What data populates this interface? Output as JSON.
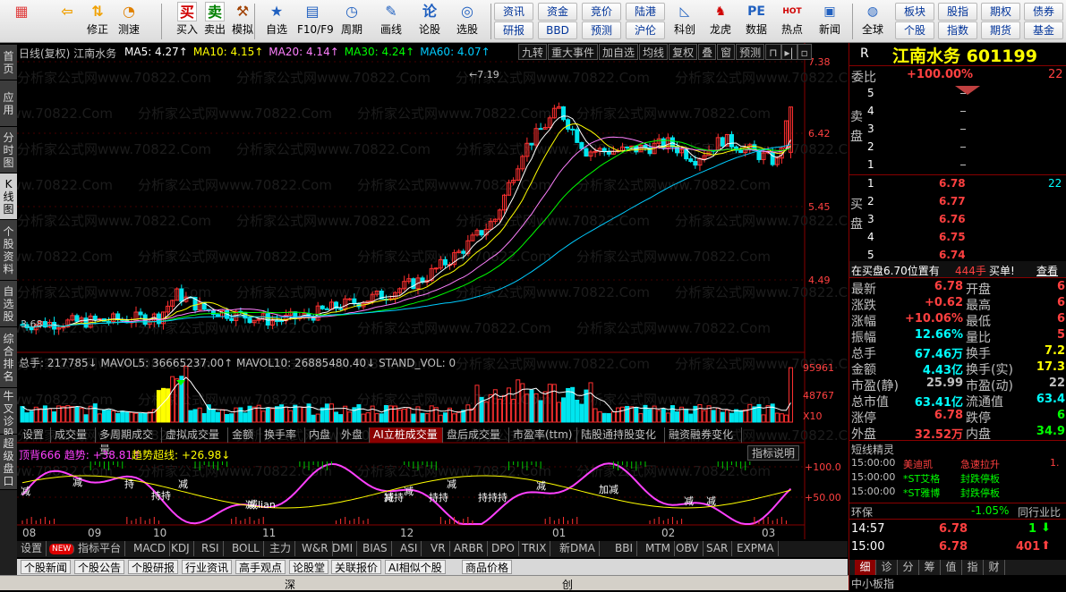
{
  "toolbar": {
    "big": [
      {
        "label": "",
        "icon": "windows-grid-icon"
      },
      {
        "label": "",
        "icon": "back-arrow-icon"
      },
      {
        "label": "修正",
        "icon": "up-down-arrows-icon"
      },
      {
        "label": "测速",
        "icon": "speed-gauge-icon"
      },
      {
        "label": "买入",
        "icon": "buy-icon",
        "glyph": "买"
      },
      {
        "label": "卖出",
        "icon": "sell-icon",
        "glyph": "卖"
      },
      {
        "label": "模拟",
        "icon": "hammer-icon"
      },
      {
        "label": "自选",
        "icon": "star-icon"
      },
      {
        "label": "F10/F9",
        "icon": "f10-icon"
      },
      {
        "label": "周期",
        "icon": "clock-icon"
      },
      {
        "label": "画线",
        "icon": "pencil-icon"
      },
      {
        "label": "论股",
        "icon": "talk-icon",
        "glyph": "论"
      },
      {
        "label": "选股",
        "icon": "select-stock-icon"
      }
    ],
    "small_top": [
      "资讯",
      "资金",
      "竞价",
      "陆港"
    ],
    "small_bottom": [
      "研报",
      "BBD",
      "预测",
      "沪伦"
    ],
    "big2": [
      {
        "label": "科创",
        "icon": "chart-icon"
      },
      {
        "label": "龙虎",
        "icon": "dragon-icon"
      },
      {
        "label": "数据",
        "icon": "pe-icon",
        "glyph": "PE"
      },
      {
        "label": "热点",
        "icon": "hot-icon",
        "glyph": "HOT"
      },
      {
        "label": "新闻",
        "icon": "news-icon"
      },
      {
        "label": "全球",
        "icon": "globe-icon"
      }
    ],
    "small2_top": [
      "板块",
      "股指",
      "期权",
      "债券"
    ],
    "small2_bottom": [
      "个股",
      "指数",
      "期货",
      "基金"
    ]
  },
  "left_tabs": [
    "首页",
    "应用",
    "分时图",
    "K线图",
    "个股资料",
    "自选股",
    "综合排名",
    "牛叉诊股",
    "超级盘口"
  ],
  "kline": {
    "header": "日线(复权) 江南水务",
    "ma": [
      {
        "label": "MA5: 4.27↑",
        "color": "#ffffff"
      },
      {
        "label": "MA10: 4.15↑",
        "color": "#ffff00"
      },
      {
        "label": "MA20: 4.14↑",
        "color": "#ff80ff"
      },
      {
        "label": "MA30: 4.24↑",
        "color": "#00ff00"
      },
      {
        "label": "MA60: 4.07↑",
        "color": "#00ccff"
      }
    ],
    "buttons": [
      "九转",
      "重大事件",
      "加自选",
      "均线",
      "复权",
      "叠",
      "窗",
      "预测"
    ],
    "price_ticks": [
      "7.38",
      "6.42",
      "5.45",
      "4.49"
    ],
    "max_label": "7.19",
    "min_label": "3.68",
    "watermark": "分析家公式网www.70822.Com"
  },
  "volume": {
    "header": "总手: 217785↓ MAVOL5: 36665237.00↑ MAVOL10: 26885480.40↓ STAND_VOL: 0",
    "ticks": [
      "95961",
      "48767",
      "X10"
    ],
    "tabs": [
      "设置",
      "成交量",
      "多周期成交量",
      "虚拟成交量",
      "金额",
      "换手率",
      "内盘",
      "外盘",
      "AI立桩成交量",
      "盘后成交量",
      "市盈率(ttm)",
      "陆股通持股变化",
      "融资融券变化"
    ]
  },
  "indicator": {
    "header_a": "顶背666 趋势: +38.81↑",
    "header_b": "趋势超线: +26.98↓",
    "explain": "指标说明",
    "ticks": [
      "+100.0",
      "+50.00"
    ],
    "labels": [
      "减",
      "减",
      "持",
      "持持",
      "减",
      "减",
      "减",
      "持持",
      "减",
      "持持",
      "减",
      "持持持",
      "减",
      "加减",
      "减",
      "减",
      "减lian"
    ]
  },
  "xaxis": [
    "08",
    "09",
    "10",
    "11",
    "12",
    "01",
    "02",
    "03"
  ],
  "indicator_tabs": [
    "设置",
    "NEW",
    "指标平台",
    "MACD",
    "KDJ",
    "RSI",
    "BOLL",
    "主力",
    "W&R",
    "DMI",
    "BIAS",
    "ASI",
    "VR",
    "ARBR",
    "DPO",
    "TRIX",
    "新DMA",
    "BBI",
    "MTM",
    "OBV",
    "SAR",
    "EXPMA"
  ],
  "bottom_tabs": [
    "个股新闻",
    "个股公告",
    "个股研报",
    "行业资讯",
    "高手观点",
    "论股堂",
    "关联报价",
    "AI相似个股",
    "商品价格"
  ],
  "side": {
    "r_label": "R",
    "title": "江南水务 601199",
    "weibi_label": "委比",
    "weibi_value": "+100.00%",
    "weibi_num": "22",
    "sell_label": "卖盘",
    "buy_label": "买盘",
    "sell": [
      {
        "n": "5",
        "p": "",
        "v": ""
      },
      {
        "n": "4",
        "p": "",
        "v": ""
      },
      {
        "n": "3",
        "p": "",
        "v": ""
      },
      {
        "n": "2",
        "p": "",
        "v": ""
      },
      {
        "n": "1",
        "p": "",
        "v": ""
      }
    ],
    "buy": [
      {
        "n": "1",
        "p": "6.78",
        "v": "22"
      },
      {
        "n": "2",
        "p": "6.77",
        "v": ""
      },
      {
        "n": "3",
        "p": "6.76",
        "v": ""
      },
      {
        "n": "4",
        "p": "6.75",
        "v": ""
      },
      {
        "n": "5",
        "p": "6.74",
        "v": ""
      }
    ],
    "bid_note": "在买盘6.70位置有",
    "bid_qty": "444手",
    "bid_action": "买单!",
    "bid_view": "查看",
    "stats": [
      [
        "最新",
        "6.78",
        "开盘",
        "6"
      ],
      [
        "涨跌",
        "+0.62",
        "最高",
        "6"
      ],
      [
        "涨幅",
        "+10.06%",
        "最低",
        "6"
      ],
      [
        "振幅",
        "12.66%",
        "量比",
        "5"
      ],
      [
        "总手",
        "67.46万",
        "换手",
        "7.2"
      ],
      [
        "金额",
        "4.43亿",
        "换手(实)",
        "17.3"
      ],
      [
        "市盈(静)",
        "25.99",
        "市盈(动)",
        "22"
      ],
      [
        "总市值",
        "63.41亿",
        "流通值",
        "63.4"
      ],
      [
        "涨停",
        "6.78",
        "跌停",
        "6"
      ],
      [
        "外盘",
        "32.52万",
        "内盘",
        "34.9"
      ]
    ],
    "short_title": "短线精灵",
    "short": [
      {
        "time": "15:00:00",
        "name": "美迪凯",
        "event": "急速拉升",
        "val": "1."
      },
      {
        "time": "15:00:00",
        "name": "*ST艾格",
        "event": "封跌停板",
        "val": ""
      },
      {
        "time": "15:00:00",
        "name": "*ST雅博",
        "event": "封跌停板",
        "val": ""
      }
    ],
    "huanbao": "环保",
    "huanbao_pct": "-1.05%",
    "industry": "同行业比",
    "ticks": [
      {
        "time": "14:57",
        "price": "6.78",
        "vol": "1"
      },
      {
        "time": "15:00",
        "price": "6.78",
        "vol": "401"
      }
    ],
    "bottom_tabs": [
      "细",
      "诊",
      "分",
      "筹",
      "值",
      "指",
      "财"
    ],
    "cut_text": "中小板指"
  },
  "status": {
    "cut_left": "深",
    "cut_mid": "创"
  }
}
